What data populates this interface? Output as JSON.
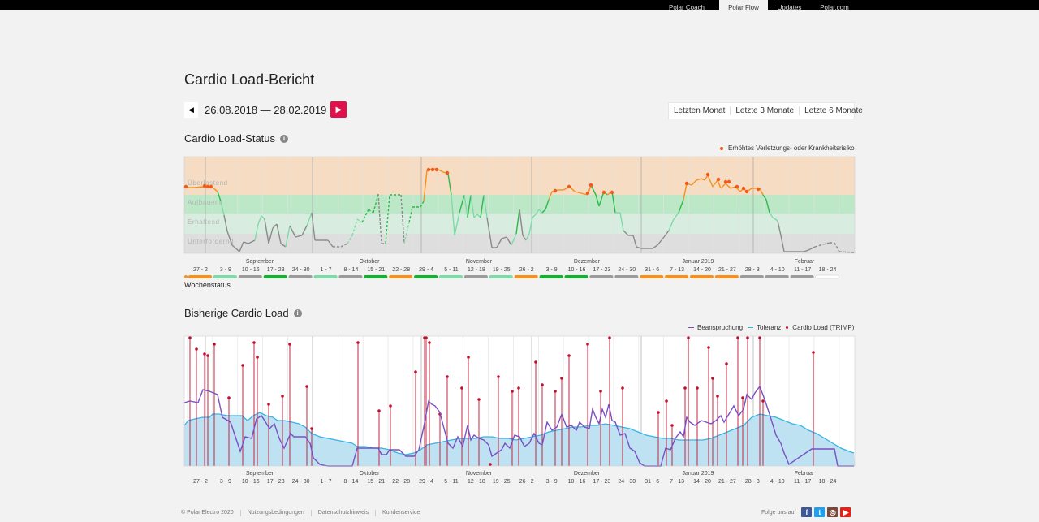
{
  "nav": {
    "items": [
      "Polar Coach",
      "Polar Flow",
      "Updates",
      "Polar.com"
    ],
    "active": "Polar Flow"
  },
  "page": {
    "title": "Cardio Load-Bericht"
  },
  "date_range": {
    "text": "26.08.2018 — 28.02.2019"
  },
  "range_buttons": [
    "Letzten Monat",
    "Letzte 3 Monate",
    "Letzte 6 Monate"
  ],
  "status": {
    "title": "Cardio Load-Status",
    "legend": "Erhöhtes Verletzungs- oder Krankheitsrisiko",
    "zones": [
      "Überlastend",
      "Aufbauend",
      "Erhaltend",
      "Unterfordernd"
    ],
    "wochenstatus_label": "Wochenstatus",
    "months": [
      "September",
      "Oktober",
      "November",
      "Dezember",
      "Januar 2019",
      "Februar"
    ],
    "weeks": [
      "27 - 2",
      "3 - 9",
      "10 - 16",
      "17 - 23",
      "24 - 30",
      "1 - 7",
      "8 - 14",
      "15 - 21",
      "22 - 28",
      "29 - 4",
      "5 - 11",
      "12 - 18",
      "19 - 25",
      "26 - 2",
      "3 - 9",
      "10 - 16",
      "17 - 23",
      "24 - 30",
      "31 - 6",
      "7 - 13",
      "14 - 20",
      "21 - 27",
      "28 - 3",
      "4 - 10",
      "11 - 17",
      "18 - 24"
    ],
    "week_status": [
      "overreaching",
      "maintaining",
      "detraining",
      "productive",
      "detraining",
      "maintaining",
      "detraining",
      "productive",
      "overreaching",
      "productive",
      "maintaining",
      "detraining",
      "maintaining",
      "overreaching",
      "productive",
      "productive",
      "detraining",
      "detraining",
      "overreaching",
      "overreaching",
      "overreaching",
      "overreaching",
      "detraining",
      "detraining",
      "detraining",
      "none"
    ]
  },
  "history": {
    "title": "Bisherige Cardio Load",
    "legend": [
      "Beanspruchung",
      "Toleranz",
      "Cardio Load (TRIMP)"
    ]
  },
  "colors": {
    "overreaching": "#f7901e",
    "productive": "#00b050",
    "maintaining": "#7ddba6",
    "detraining": "#999999",
    "strain": "#7a4fc4",
    "tolerance": "#36b4e6",
    "load": "#c0102e",
    "accent": "#e0104a"
  },
  "footer": {
    "links": [
      "© Polar Electro 2020",
      "Nutzungsbedingungen",
      "Datenschutzhinweis",
      "Kundenservice"
    ],
    "follow": "Folge uns auf"
  },
  "social": [
    "facebook-icon",
    "twitter-icon",
    "instagram-icon",
    "youtube-icon"
  ]
}
